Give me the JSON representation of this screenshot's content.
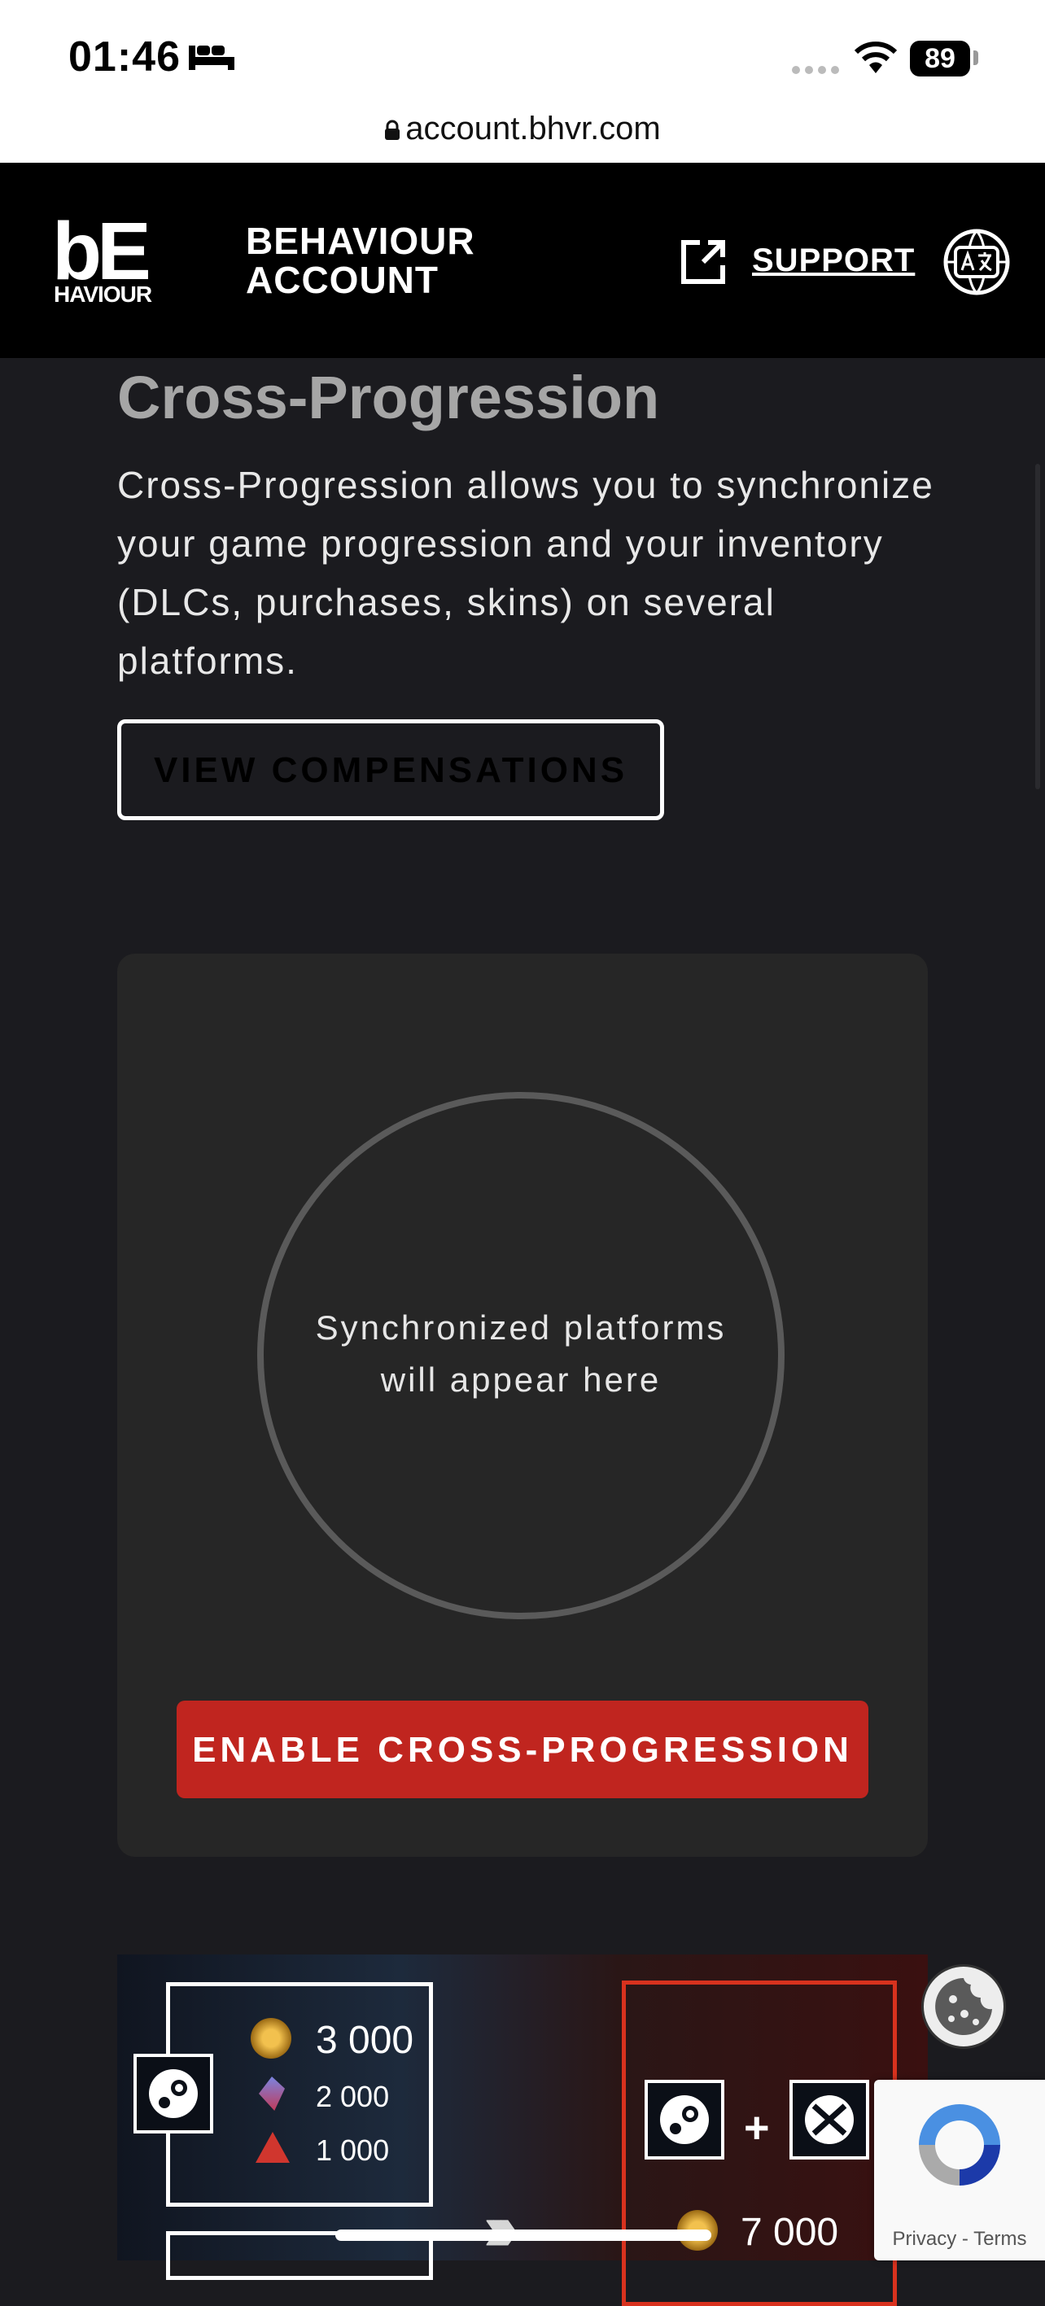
{
  "status_bar": {
    "time": "01:46",
    "battery": "89"
  },
  "browser": {
    "url": "account.bhvr.com"
  },
  "header": {
    "logo_top": "bE",
    "logo_bottom": "HAVIOUR",
    "brand_line1": "BEHAVIOUR",
    "brand_line2": "ACCOUNT",
    "support_label": "SUPPORT"
  },
  "section": {
    "title": "Cross-Progression",
    "description": "Cross-Progression allows you to synchronize your game progression and your inventory (DLCs, purchases, skins) on several platforms.",
    "view_compensations": "VIEW COMPENSATIONS"
  },
  "sync_card": {
    "placeholder_line1": "Synchronized platforms",
    "placeholder_line2": "will appear here",
    "enable_button": "ENABLE CROSS-PROGRESSION"
  },
  "banner": {
    "left_amounts": [
      "3 000",
      "2 000",
      "1 000"
    ],
    "plus": "+",
    "right_amount": "7 000"
  },
  "recaptcha": {
    "privacy": "Privacy",
    "separator": " - ",
    "terms": "Terms"
  },
  "colors": {
    "accent_red": "#c0251f",
    "background": "#1b1b1f",
    "card": "#262626"
  }
}
